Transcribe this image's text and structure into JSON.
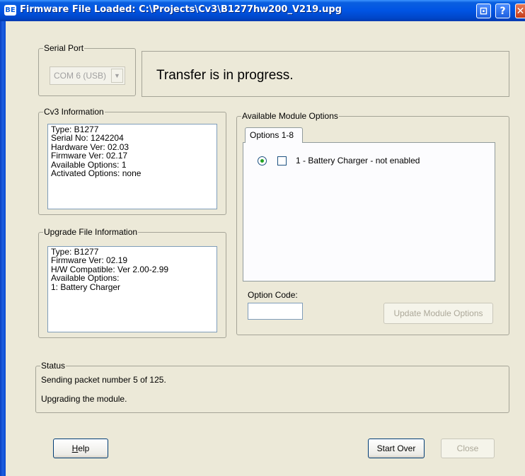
{
  "window": {
    "title": "Firmware File Loaded: C:\\Projects\\Cv3\\B1277hw200_V219.upg",
    "icon_text": "BE",
    "buttons": {
      "restore": "⊡",
      "help": "?",
      "close": "✕"
    }
  },
  "serial_port": {
    "legend": "Serial Port",
    "selected": "COM 6 (USB)",
    "arrow": "▼"
  },
  "transfer_message": "Transfer is in progress.",
  "cv3_info": {
    "legend": "Cv3 Information",
    "lines": [
      "Type: B1277",
      "Serial No: 1242204",
      "Hardware Ver: 02.03",
      "Firmware Ver: 02.17",
      "Available Options: 1",
      "Activated Options: none"
    ]
  },
  "upgrade_info": {
    "legend": "Upgrade File Information",
    "lines": [
      "Type: B1277",
      "Firmware Ver: 02.19",
      "H/W Compatible: Ver 2.00-2.99",
      "Available Options:",
      "1: Battery Charger"
    ]
  },
  "module_options": {
    "legend": "Available Module Options",
    "tab_label": "Options 1-8",
    "option_label": "1 - Battery Charger - not enabled",
    "code_label": "Option Code:",
    "code_value": "",
    "update_button": "Update Module Options"
  },
  "status": {
    "legend": "Status",
    "line1": "Sending packet number 5 of 125.",
    "line2": "Upgrading the module."
  },
  "footer": {
    "help_hotkey": "H",
    "help_rest": "elp",
    "start_over": "Start Over",
    "close": "Close"
  }
}
